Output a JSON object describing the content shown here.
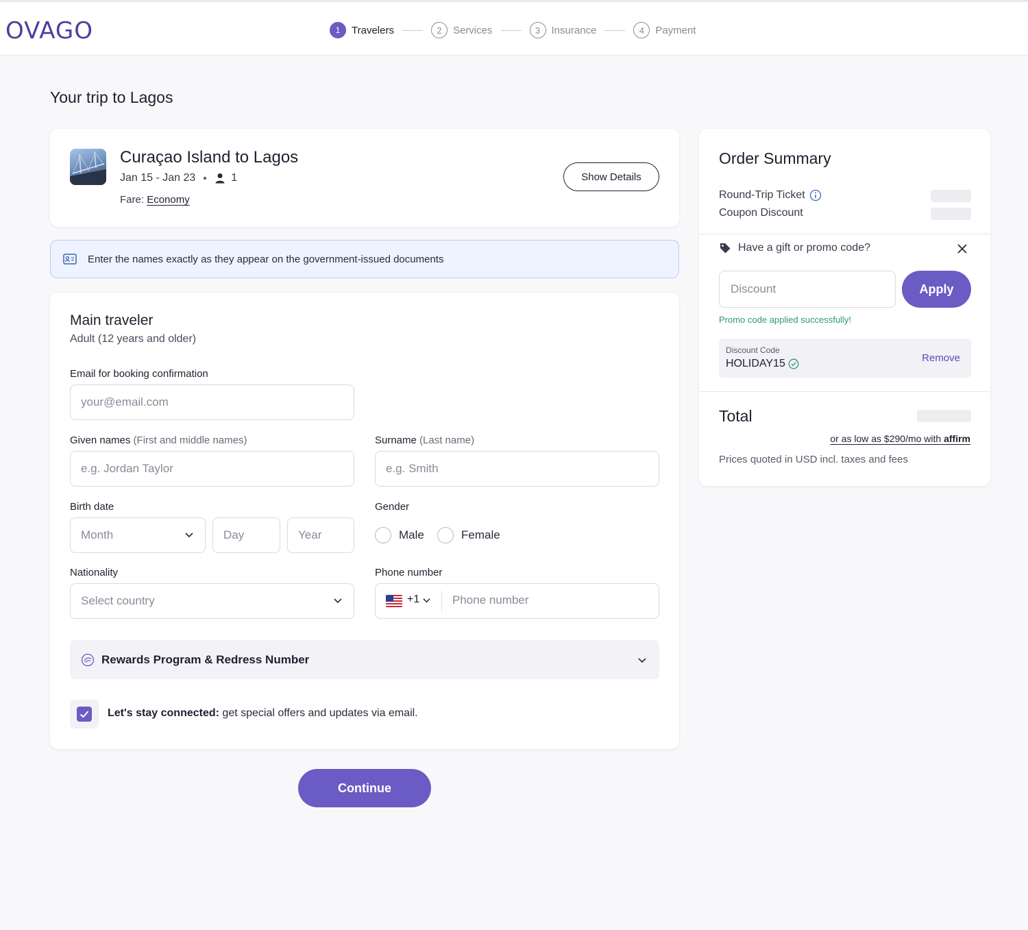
{
  "brand": {
    "logo": "OVAGO"
  },
  "steps": [
    {
      "num": "1",
      "label": "Travelers"
    },
    {
      "num": "2",
      "label": "Services"
    },
    {
      "num": "3",
      "label": "Insurance"
    },
    {
      "num": "4",
      "label": "Payment"
    }
  ],
  "page_title": "Your trip to Lagos",
  "trip": {
    "route": "Curaçao Island to Lagos",
    "dates": "Jan 15 - Jan 23",
    "travelers": "1",
    "fare_label": "Fare:",
    "fare_value": "Economy",
    "show_details": "Show Details"
  },
  "notice": "Enter the names exactly as they appear on the government-issued documents",
  "traveler": {
    "title": "Main traveler",
    "subtitle": "Adult (12 years and older)",
    "email_label": "Email for booking confirmation",
    "email_placeholder": "your@email.com",
    "given_label": "Given names",
    "given_hint": "(First and middle names)",
    "given_placeholder": "e.g. Jordan Taylor",
    "surname_label": "Surname",
    "surname_hint": "(Last name)",
    "surname_placeholder": "e.g. Smith",
    "birth_label": "Birth date",
    "month_placeholder": "Month",
    "day_placeholder": "Day",
    "year_placeholder": "Year",
    "gender_label": "Gender",
    "gender_male": "Male",
    "gender_female": "Female",
    "nationality_label": "Nationality",
    "nationality_placeholder": "Select country",
    "phone_label": "Phone number",
    "phone_code": "+1",
    "phone_placeholder": "Phone number",
    "rewards": "Rewards Program & Redress Number",
    "stay_bold": "Let's stay connected:",
    "stay_text": " get special offers and updates via email.",
    "stay_checked": true
  },
  "continue": "Continue",
  "summary": {
    "title": "Order Summary",
    "round_trip": "Round-Trip Ticket",
    "coupon": "Coupon Discount",
    "promo_question": "Have a gift or promo code?",
    "discount_placeholder": "Discount",
    "apply": "Apply",
    "promo_success": "Promo code applied successfully!",
    "code_label": "Discount Code",
    "code_value": "HOLIDAY15",
    "remove": "Remove",
    "total": "Total",
    "affirm_text": "or as low as $290/mo with",
    "affirm_brand": "affirm",
    "prices_note": "Prices quoted in USD incl. taxes and fees"
  },
  "colors": {
    "accent": "#6b5bc4",
    "success": "#2c9d6a",
    "notice_bg": "#eef3ff"
  }
}
